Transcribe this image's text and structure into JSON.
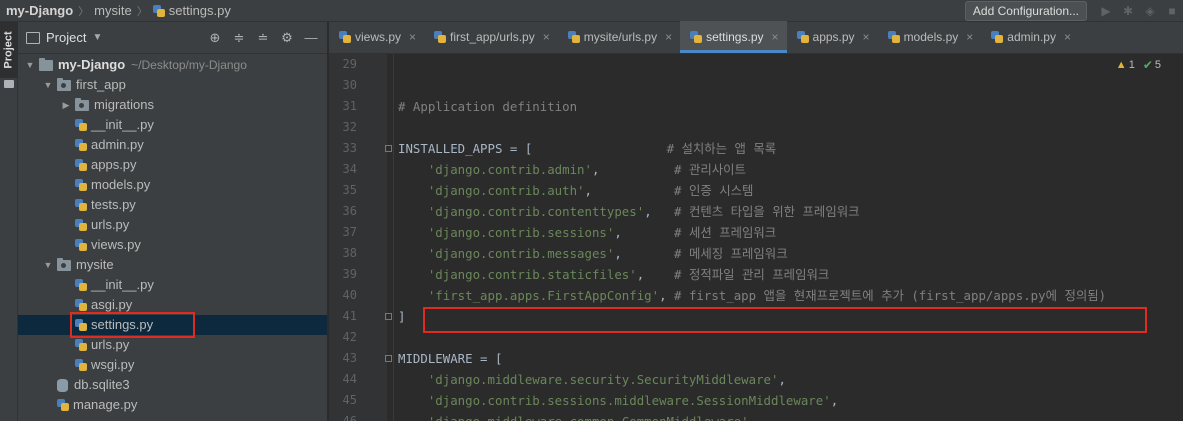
{
  "breadcrumbs": [
    "my-Django",
    "mysite",
    "settings.py"
  ],
  "toolbar": {
    "add_configuration": "Add Configuration..."
  },
  "toolstrip": {
    "project_label": "Project"
  },
  "project_panel": {
    "title": "Project",
    "tree": [
      {
        "label": "my-Django",
        "path": "~/Desktop/my-Django",
        "depth": 0,
        "kind": "folder",
        "expanded": true,
        "bold": true
      },
      {
        "label": "first_app",
        "depth": 1,
        "kind": "package",
        "expanded": true
      },
      {
        "label": "migrations",
        "depth": 2,
        "kind": "package",
        "expanded": false
      },
      {
        "label": "__init__.py",
        "depth": 2,
        "kind": "python"
      },
      {
        "label": "admin.py",
        "depth": 2,
        "kind": "python"
      },
      {
        "label": "apps.py",
        "depth": 2,
        "kind": "python"
      },
      {
        "label": "models.py",
        "depth": 2,
        "kind": "python"
      },
      {
        "label": "tests.py",
        "depth": 2,
        "kind": "python"
      },
      {
        "label": "urls.py",
        "depth": 2,
        "kind": "python"
      },
      {
        "label": "views.py",
        "depth": 2,
        "kind": "python"
      },
      {
        "label": "mysite",
        "depth": 1,
        "kind": "package",
        "expanded": true
      },
      {
        "label": "__init__.py",
        "depth": 2,
        "kind": "python"
      },
      {
        "label": "asgi.py",
        "depth": 2,
        "kind": "python"
      },
      {
        "label": "settings.py",
        "depth": 2,
        "kind": "python",
        "selected": true
      },
      {
        "label": "urls.py",
        "depth": 2,
        "kind": "python"
      },
      {
        "label": "wsgi.py",
        "depth": 2,
        "kind": "python"
      },
      {
        "label": "db.sqlite3",
        "depth": 1,
        "kind": "db"
      },
      {
        "label": "manage.py",
        "depth": 1,
        "kind": "python"
      }
    ]
  },
  "editor": {
    "tabs": [
      {
        "label": "views.py"
      },
      {
        "label": "first_app/urls.py"
      },
      {
        "label": "mysite/urls.py"
      },
      {
        "label": "settings.py",
        "active": true
      },
      {
        "label": "apps.py"
      },
      {
        "label": "models.py"
      },
      {
        "label": "admin.py"
      }
    ],
    "inspection": {
      "warnings": "1",
      "ok": "5"
    },
    "lines": [
      {
        "num": "29",
        "text": ""
      },
      {
        "num": "30",
        "text": ""
      },
      {
        "num": "31",
        "parts": [
          {
            "t": "# Application definition",
            "c": "cmt"
          }
        ]
      },
      {
        "num": "32",
        "text": ""
      },
      {
        "num": "33",
        "parts": [
          {
            "t": "INSTALLED_APPS = [                  ",
            "c": "kw"
          },
          {
            "t": "# 설치하는 앱 목록",
            "c": "cmt"
          }
        ]
      },
      {
        "num": "34",
        "parts": [
          {
            "t": "    ",
            "c": "kw"
          },
          {
            "t": "'django.contrib.admin'",
            "c": "str"
          },
          {
            "t": ",          ",
            "c": "kw"
          },
          {
            "t": "# 관리사이트",
            "c": "cmt"
          }
        ]
      },
      {
        "num": "35",
        "parts": [
          {
            "t": "    ",
            "c": "kw"
          },
          {
            "t": "'django.contrib.auth'",
            "c": "str"
          },
          {
            "t": ",           ",
            "c": "kw"
          },
          {
            "t": "# 인증 시스템",
            "c": "cmt"
          }
        ]
      },
      {
        "num": "36",
        "parts": [
          {
            "t": "    ",
            "c": "kw"
          },
          {
            "t": "'django.contrib.contenttypes'",
            "c": "str"
          },
          {
            "t": ",   ",
            "c": "kw"
          },
          {
            "t": "# 컨텐츠 타입을 위한 프레임워크",
            "c": "cmt"
          }
        ]
      },
      {
        "num": "37",
        "parts": [
          {
            "t": "    ",
            "c": "kw"
          },
          {
            "t": "'django.contrib.sessions'",
            "c": "str"
          },
          {
            "t": ",       ",
            "c": "kw"
          },
          {
            "t": "# 세션 프레임워크",
            "c": "cmt"
          }
        ]
      },
      {
        "num": "38",
        "parts": [
          {
            "t": "    ",
            "c": "kw"
          },
          {
            "t": "'django.contrib.messages'",
            "c": "str"
          },
          {
            "t": ",       ",
            "c": "kw"
          },
          {
            "t": "# 메세징 프레임워크",
            "c": "cmt"
          }
        ]
      },
      {
        "num": "39",
        "parts": [
          {
            "t": "    ",
            "c": "kw"
          },
          {
            "t": "'django.contrib.staticfiles'",
            "c": "str"
          },
          {
            "t": ",    ",
            "c": "kw"
          },
          {
            "t": "# 정적파일 관리 프레임워크",
            "c": "cmt"
          }
        ]
      },
      {
        "num": "40",
        "parts": [
          {
            "t": "    ",
            "c": "kw"
          },
          {
            "t": "'first_app.apps.FirstAppConfig'",
            "c": "str"
          },
          {
            "t": ", ",
            "c": "kw"
          },
          {
            "t": "# first_app 앱을 현재프로젝트에 추가 (first_app/apps.py에 정의됨)",
            "c": "cmt"
          }
        ]
      },
      {
        "num": "41",
        "parts": [
          {
            "t": "]",
            "c": "kw"
          }
        ]
      },
      {
        "num": "42",
        "text": ""
      },
      {
        "num": "43",
        "parts": [
          {
            "t": "MIDDLEWARE = [",
            "c": "kw"
          }
        ]
      },
      {
        "num": "44",
        "parts": [
          {
            "t": "    ",
            "c": "kw"
          },
          {
            "t": "'django.middleware.security.SecurityMiddleware'",
            "c": "str"
          },
          {
            "t": ",",
            "c": "kw"
          }
        ]
      },
      {
        "num": "45",
        "parts": [
          {
            "t": "    ",
            "c": "kw"
          },
          {
            "t": "'django.contrib.sessions.middleware.SessionMiddleware'",
            "c": "str"
          },
          {
            "t": ",",
            "c": "kw"
          }
        ]
      },
      {
        "num": "46",
        "parts": [
          {
            "t": "    ",
            "c": "kw"
          },
          {
            "t": "'django.middleware.common.CommonMiddleware'",
            "c": "str"
          },
          {
            "t": ",",
            "c": "kw"
          }
        ]
      }
    ]
  },
  "colors": {
    "highlight_box": "#e02b20",
    "selection": "#0d293e",
    "string": "#6a8759",
    "comment": "#808080"
  }
}
